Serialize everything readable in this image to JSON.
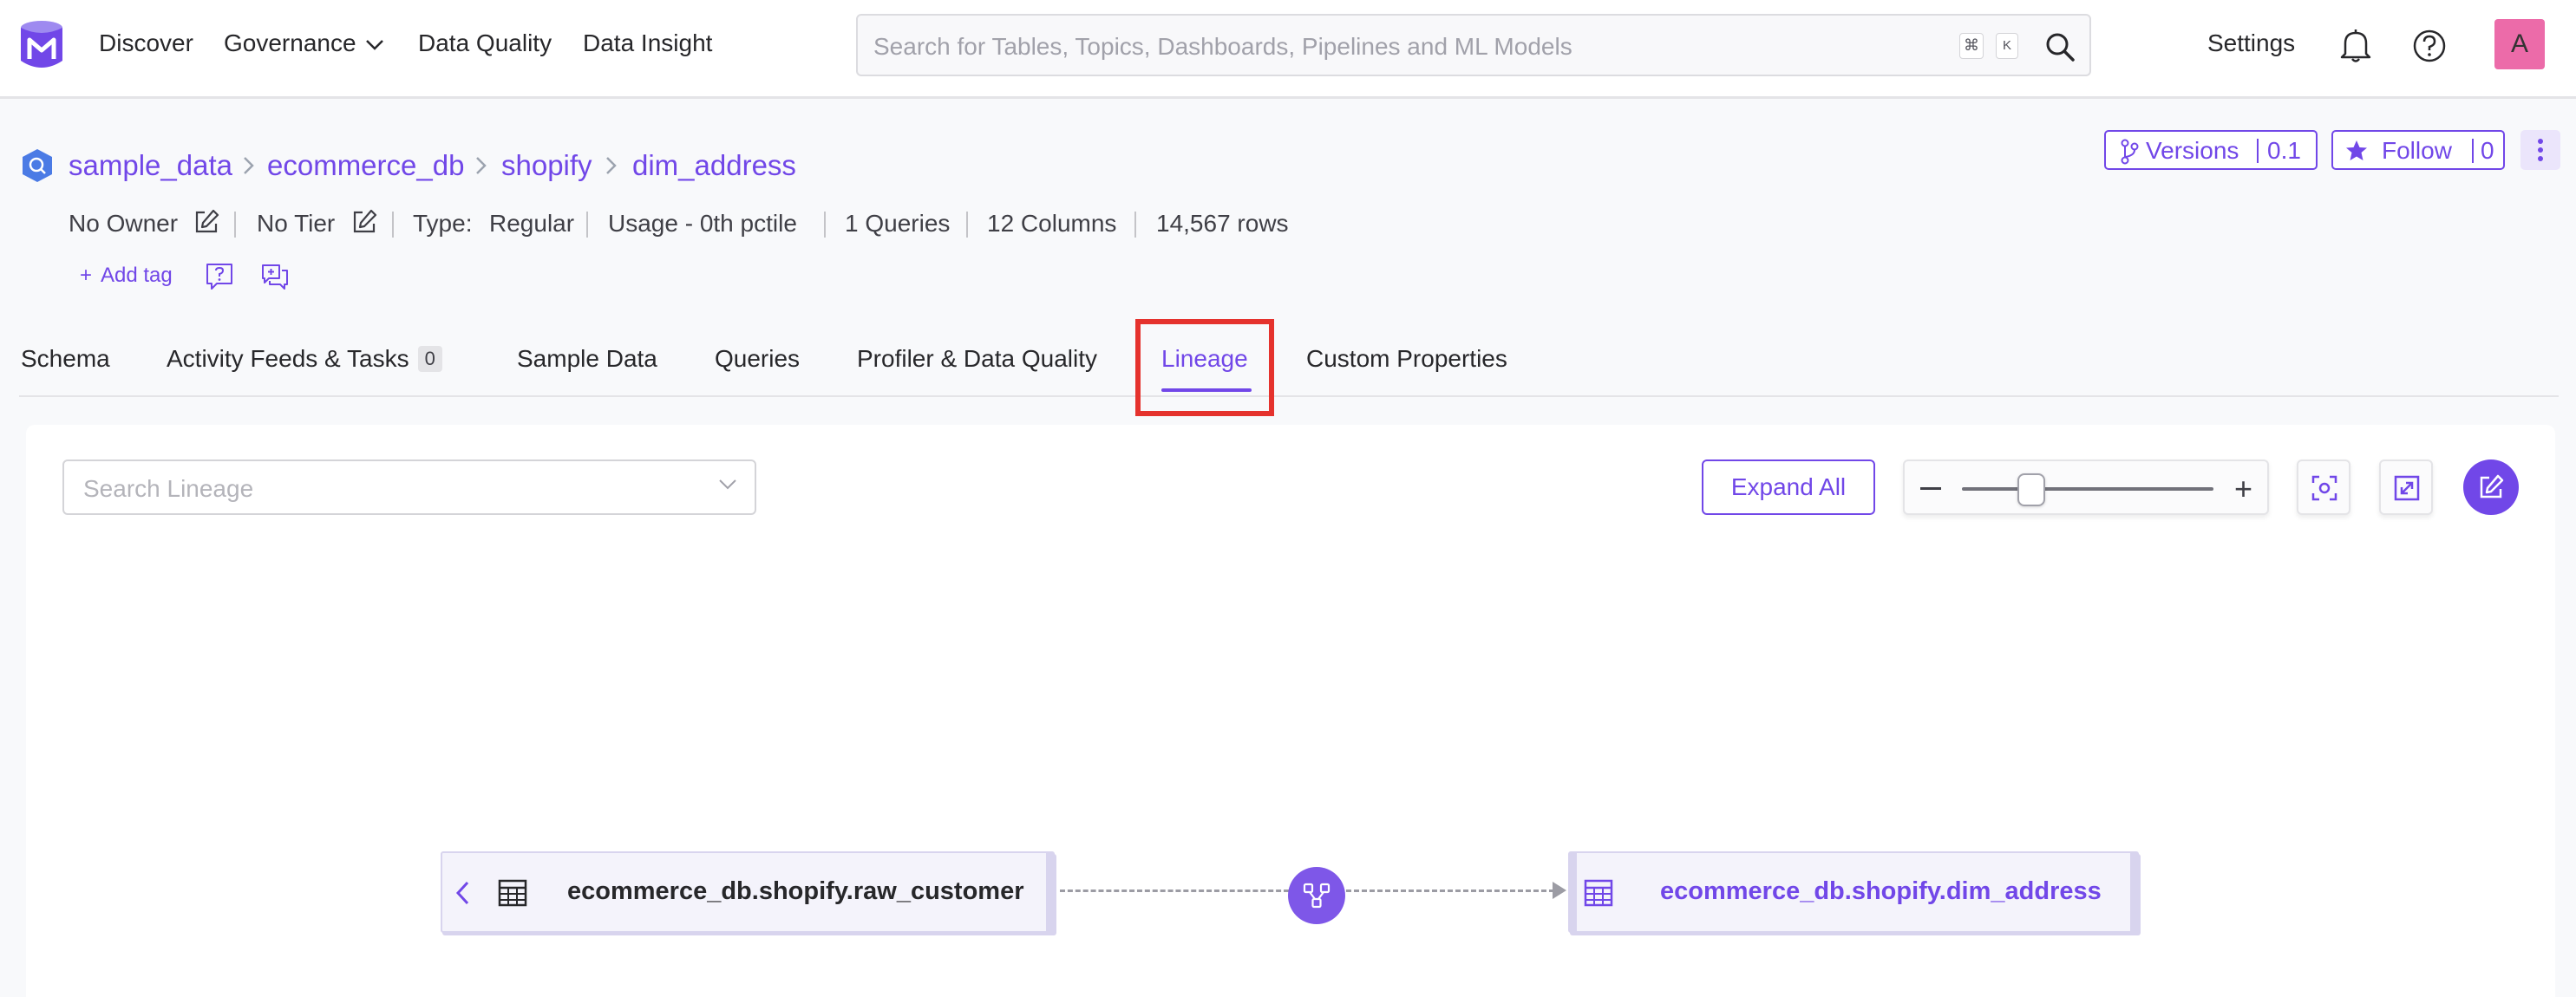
{
  "navbar": {
    "items": [
      "Discover",
      "Governance",
      "Data Quality",
      "Data Insight"
    ],
    "search_placeholder": "Search for Tables, Topics, Dashboards, Pipelines and ML Models",
    "kbd_cmd": "⌘",
    "kbd_k": "K",
    "settings": "Settings",
    "avatar_letter": "A"
  },
  "breadcrumb": [
    "sample_data",
    "ecommerce_db",
    "shopify",
    "dim_address"
  ],
  "header_actions": {
    "versions_label": "Versions",
    "versions_value": "0.1",
    "follow_label": "Follow",
    "follow_value": "0"
  },
  "meta": {
    "owner": "No Owner",
    "tier": "No Tier",
    "type_label": "Type:",
    "type_value": "Regular",
    "usage": "Usage - 0th pctile",
    "queries": "1 Queries",
    "columns": "12 Columns",
    "rows": "14,567 rows",
    "add_tag": "Add tag"
  },
  "tabs": [
    {
      "label": "Schema"
    },
    {
      "label": "Activity Feeds & Tasks",
      "count": "0"
    },
    {
      "label": "Sample Data"
    },
    {
      "label": "Queries"
    },
    {
      "label": "Profiler & Data Quality"
    },
    {
      "label": "Lineage",
      "active": true
    },
    {
      "label": "Custom Properties"
    }
  ],
  "lineage": {
    "search_placeholder": "Search Lineage",
    "expand_all": "Expand All",
    "source_node": "ecommerce_db.shopify.raw_customer",
    "target_node": "ecommerce_db.shopify.dim_address"
  },
  "colors": {
    "accent": "#7147e8",
    "highlight_border": "#e5322d",
    "avatar_bg": "#ec6ba9"
  }
}
